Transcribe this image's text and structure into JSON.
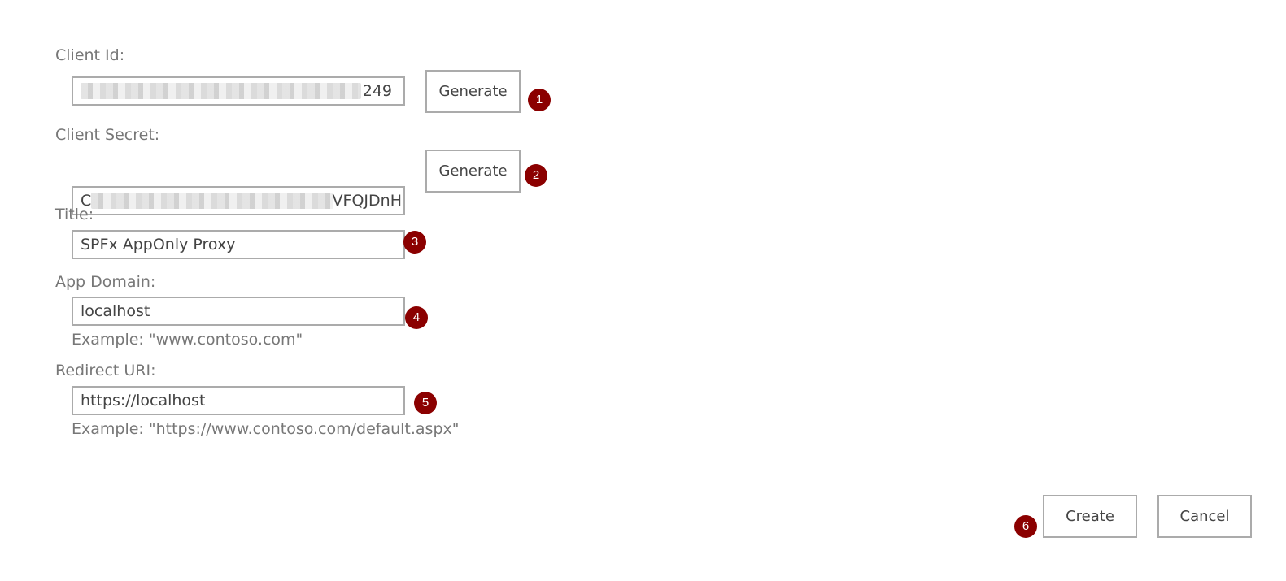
{
  "form": {
    "client_id": {
      "label": "Client Id:",
      "value_visible_tail": "249",
      "generate_label": "Generate",
      "step": "1"
    },
    "client_secret": {
      "label": "Client Secret:",
      "value_visible_head": "C",
      "value_visible_tail": "VFQJDnH",
      "generate_label": "Generate",
      "step": "2"
    },
    "title": {
      "label": "Title:",
      "value": "SPFx AppOnly Proxy",
      "step": "3"
    },
    "app_domain": {
      "label": "App Domain:",
      "value": "localhost",
      "hint": "Example: \"www.contoso.com\"",
      "step": "4"
    },
    "redirect_uri": {
      "label": "Redirect URI:",
      "value": "https://localhost",
      "hint": "Example: \"https://www.contoso.com/default.aspx\"",
      "step": "5"
    }
  },
  "actions": {
    "create_label": "Create",
    "cancel_label": "Cancel",
    "step": "6"
  },
  "colors": {
    "badge": "#8b0000",
    "border": "#ababab",
    "label": "#777777",
    "text": "#444444"
  }
}
